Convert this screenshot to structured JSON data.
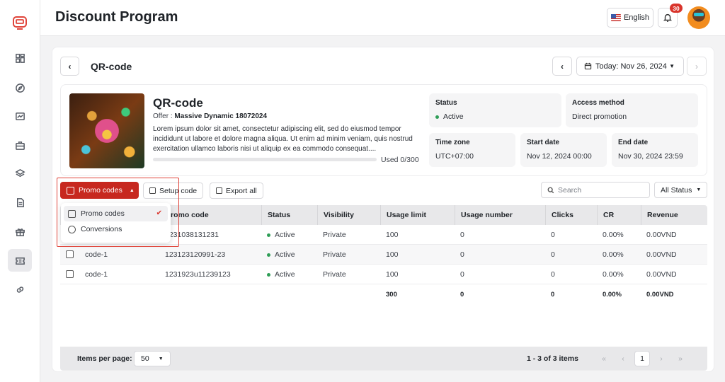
{
  "header": {
    "title": "Discount Program",
    "language": "English",
    "notification_count": "30"
  },
  "sidebar": {
    "items": [
      {
        "name": "dashboard"
      },
      {
        "name": "explore"
      },
      {
        "name": "finance"
      },
      {
        "name": "briefcase"
      },
      {
        "name": "layers"
      },
      {
        "name": "document"
      },
      {
        "name": "gift"
      },
      {
        "name": "ticket",
        "active": true
      },
      {
        "name": "link"
      }
    ]
  },
  "card": {
    "title": "QR-code",
    "date_label": "Today: Nov 26, 2024"
  },
  "offer": {
    "title": "QR-code",
    "offer_prefix": "Offer : ",
    "offer_name": "Massive Dynamic 18072024",
    "description": "Lorem ipsum dolor sit amet, consectetur adipiscing elit, sed do eiusmod tempor incididunt ut labore et dolore magna aliqua. Ut enim ad minim veniam, quis nostrud exercitation ullamco laboris nisi ut aliquip ex ea commodo consequat....",
    "usage_text": "Used 0/300",
    "usage_fraction": 0
  },
  "info": {
    "status_label": "Status",
    "status_value": "Active",
    "access_label": "Access method",
    "access_value": "Direct promotion",
    "timezone_label": "Time zone",
    "timezone_value": "UTC+07:00",
    "start_label": "Start date",
    "start_value": "Nov 12, 2024 00:00",
    "end_label": "End date",
    "end_value": "Nov 30, 2024 23:59"
  },
  "toolbar": {
    "tab_label": "Promo codes",
    "setup_label": "Setup code",
    "export_label": "Export all",
    "search_placeholder": "Search",
    "status_filter": "All Status"
  },
  "dropdown": {
    "items": [
      {
        "label": "Promo codes",
        "selected": true
      },
      {
        "label": "Conversions"
      }
    ]
  },
  "table": {
    "headers": [
      "",
      "Promo code",
      "Status",
      "Visibility",
      "Usage limit",
      "Usage number",
      "Clicks",
      "CR",
      "Revenue"
    ],
    "rows": [
      {
        "name": "",
        "code": "1231038131231",
        "status": "Active",
        "visibility": "Private",
        "limit": "100",
        "used": "0",
        "clicks": "0",
        "cr": "0.00%",
        "revenue": "0.00VND"
      },
      {
        "name": "code-1",
        "code": "123123120991-23",
        "status": "Active",
        "visibility": "Private",
        "limit": "100",
        "used": "0",
        "clicks": "0",
        "cr": "0.00%",
        "revenue": "0.00VND"
      },
      {
        "name": "code-1",
        "code": "1231923u11239123",
        "status": "Active",
        "visibility": "Private",
        "limit": "100",
        "used": "0",
        "clicks": "0",
        "cr": "0.00%",
        "revenue": "0.00VND"
      }
    ],
    "totals": {
      "limit": "300",
      "used": "0",
      "clicks": "0",
      "cr": "0.00%",
      "revenue": "0.00VND"
    }
  },
  "pagination": {
    "items_per_page_label": "Items per page:",
    "items_per_page": "50",
    "range": "1 - 3 of 3 items",
    "current_page": "1"
  },
  "colors": {
    "accent": "#c7281f",
    "active_status": "#2f9e57",
    "highlight": "#e0443a"
  }
}
